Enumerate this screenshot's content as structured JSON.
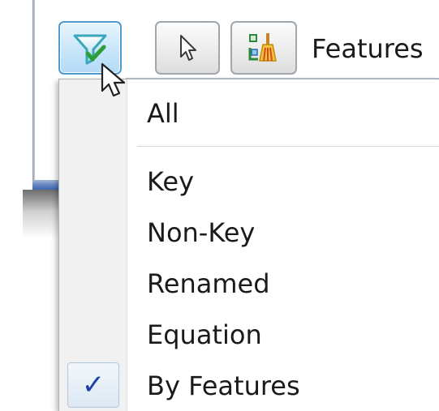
{
  "toolbar": {
    "filter_icon": "filter-check-icon",
    "select_icon": "arrow-pointer-icon",
    "feature_icon": "feature-broom-icon",
    "label": "Features"
  },
  "menu": {
    "items": [
      {
        "label": "All",
        "checked": false
      },
      {
        "label": "Key",
        "checked": false
      },
      {
        "label": "Non-Key",
        "checked": false
      },
      {
        "label": "Renamed",
        "checked": false
      },
      {
        "label": "Equation",
        "checked": false
      },
      {
        "label": "By Features",
        "checked": true
      }
    ],
    "check_glyph": "✓"
  },
  "colors": {
    "accent_blue": "#4f9ad0",
    "check_blue": "#1d3fa8",
    "funnel_teal": "#3aa6b9",
    "check_green": "#2e9e3a"
  }
}
